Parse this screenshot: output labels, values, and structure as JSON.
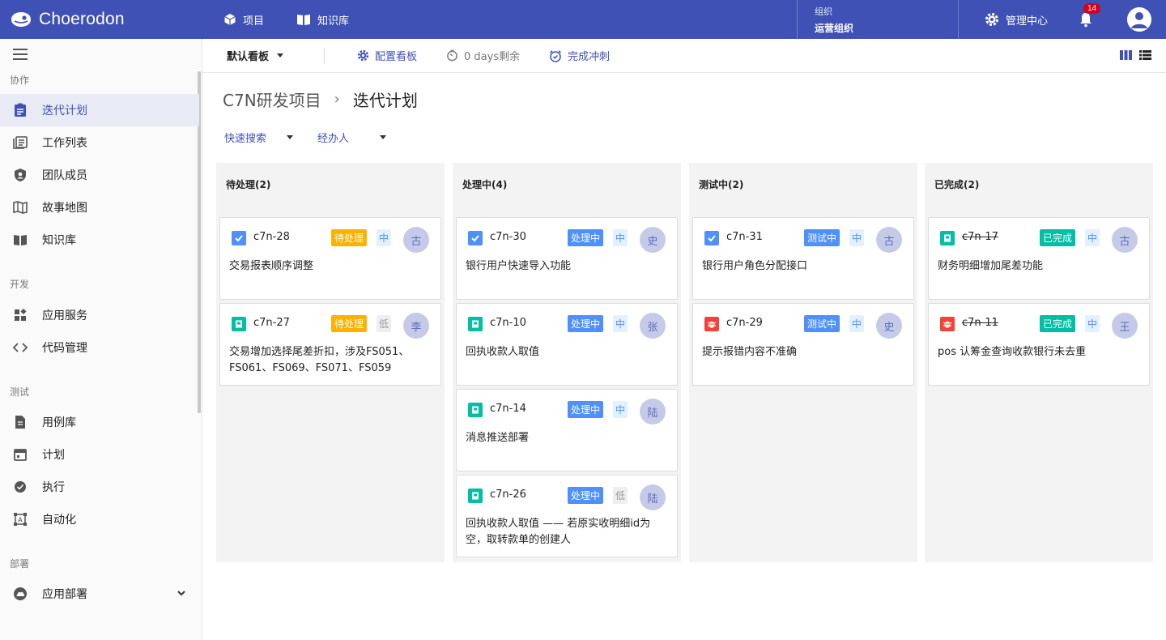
{
  "app": {
    "name": "Choerodon"
  },
  "topnav": {
    "items": [
      {
        "label": "项目",
        "icon": "cube-icon"
      },
      {
        "label": "知识库",
        "icon": "book-icon"
      }
    ]
  },
  "org": {
    "label": "组织",
    "value": "运营组织"
  },
  "admin": {
    "label": "管理中心"
  },
  "notifications": {
    "count": "14"
  },
  "sidebar": {
    "groups": [
      {
        "label": "协作",
        "items": [
          {
            "label": "迭代计划",
            "icon": "assignment-icon",
            "active": true
          },
          {
            "label": "工作列表",
            "icon": "list-icon"
          },
          {
            "label": "团队成员",
            "icon": "shield-user-icon"
          },
          {
            "label": "故事地图",
            "icon": "map-icon"
          },
          {
            "label": "知识库",
            "icon": "book-icon"
          }
        ]
      },
      {
        "label": "开发",
        "items": [
          {
            "label": "应用服务",
            "icon": "widgets-icon"
          },
          {
            "label": "代码管理",
            "icon": "code-icon"
          }
        ]
      },
      {
        "label": "测试",
        "items": [
          {
            "label": "用例库",
            "icon": "document-icon"
          },
          {
            "label": "计划",
            "icon": "calendar-icon"
          },
          {
            "label": "执行",
            "icon": "check-circle-icon"
          },
          {
            "label": "自动化",
            "icon": "automation-icon"
          }
        ]
      },
      {
        "label": "部署",
        "items": [
          {
            "label": "应用部署",
            "icon": "cloud-icon"
          }
        ]
      }
    ]
  },
  "subheader": {
    "board": "默认看板",
    "configure": "配置看板",
    "remaining": "0 days剩余",
    "complete": "完成冲刺"
  },
  "breadcrumb": {
    "project": "C7N研发项目",
    "page": "迭代计划"
  },
  "filters": {
    "quick_search": "快速搜索",
    "assignee": "经办人"
  },
  "colors": {
    "primary": "#3f51b5",
    "todo": "#ffb100",
    "doing": "#4d90fe",
    "testing": "#4d90fe",
    "done": "#00bfa5",
    "story": "#00bfa5",
    "task": "#4d90fe",
    "bug": "#f44336"
  },
  "columns": [
    {
      "title": "待处理(2)",
      "cards": [
        {
          "type": "task",
          "key": "c7n-28",
          "status": "待处理",
          "status_color": "#ffb100",
          "priority": "中",
          "assignee": "古",
          "summary": "交易报表顺序调整",
          "done": false
        },
        {
          "type": "story",
          "key": "c7n-27",
          "status": "待处理",
          "status_color": "#ffb100",
          "priority": "低",
          "assignee": "李",
          "summary": "交易增加选择尾差折扣，涉及FS051、FS061、FS069、FS071、FS059",
          "done": false
        }
      ]
    },
    {
      "title": "处理中(4)",
      "cards": [
        {
          "type": "task",
          "key": "c7n-30",
          "status": "处理中",
          "status_color": "#4d90fe",
          "priority": "中",
          "assignee": "史",
          "summary": "银行用户快速导入功能",
          "done": false
        },
        {
          "type": "story",
          "key": "c7n-10",
          "status": "处理中",
          "status_color": "#4d90fe",
          "priority": "中",
          "assignee": "张",
          "summary": "回执收款人取值",
          "done": false
        },
        {
          "type": "story",
          "key": "c7n-14",
          "status": "处理中",
          "status_color": "#4d90fe",
          "priority": "中",
          "assignee": "陆",
          "summary": "消息推送部署",
          "done": false
        },
        {
          "type": "story",
          "key": "c7n-26",
          "status": "处理中",
          "status_color": "#4d90fe",
          "priority": "低",
          "assignee": "陆",
          "summary": "回执收款人取值 —— 若原实收明细id为空，取转款单的创建人",
          "done": false
        }
      ]
    },
    {
      "title": "测试中(2)",
      "cards": [
        {
          "type": "task",
          "key": "c7n-31",
          "status": "测试中",
          "status_color": "#4d90fe",
          "priority": "中",
          "assignee": "古",
          "summary": "银行用户角色分配接口",
          "done": false
        },
        {
          "type": "bug",
          "key": "c7n-29",
          "status": "测试中",
          "status_color": "#4d90fe",
          "priority": "中",
          "assignee": "史",
          "summary": "提示报错内容不准确",
          "done": false
        }
      ]
    },
    {
      "title": "已完成(2)",
      "cards": [
        {
          "type": "story",
          "key": "c7n-17",
          "status": "已完成",
          "status_color": "#00bfa5",
          "priority": "中",
          "assignee": "古",
          "summary": "财务明细增加尾差功能",
          "done": true
        },
        {
          "type": "bug",
          "key": "c7n-11",
          "status": "已完成",
          "status_color": "#00bfa5",
          "priority": "中",
          "assignee": "王",
          "summary": "pos 认筹金查询收款银行未去重",
          "done": true
        }
      ]
    }
  ]
}
